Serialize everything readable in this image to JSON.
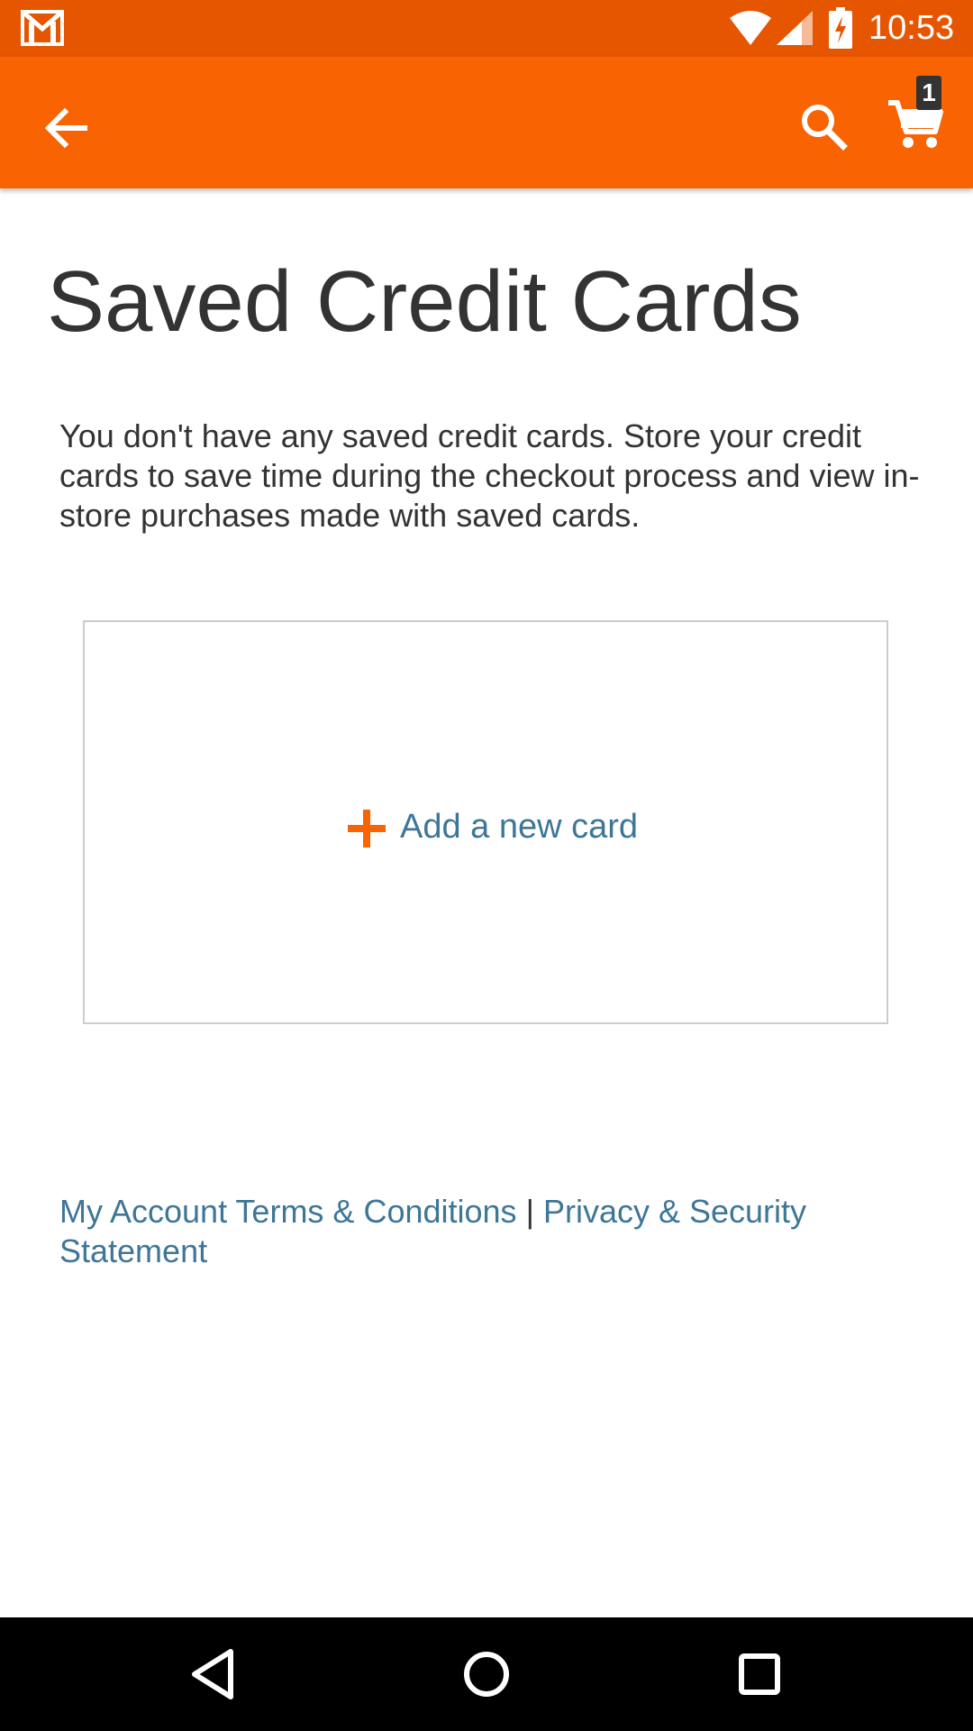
{
  "status_bar": {
    "time": "10:53",
    "icons": [
      "gmail-icon",
      "wifi-icon",
      "signal-icon",
      "battery-charging-icon"
    ]
  },
  "app_bar": {
    "back_icon": "arrow-back-icon",
    "search_icon": "search-icon",
    "cart_icon": "cart-icon",
    "cart_count": "1",
    "brand_color": "#f96302"
  },
  "main": {
    "title": "Saved Credit Cards",
    "intro": "You don't have any saved credit cards. Store your credit cards to save time during the checkout process and view in-store purchases made with saved cards.",
    "add_card_label": "Add a new card",
    "add_card_icon": "plus-icon"
  },
  "footer": {
    "terms_link": "My Account Terms & Conditions",
    "separator": "|",
    "privacy_link": "Privacy & Security Statement"
  },
  "nav_bar": {
    "icons": [
      "nav-back-icon",
      "nav-home-icon",
      "nav-recents-icon"
    ]
  },
  "colors": {
    "status_bar": "#e65500",
    "link": "#3e7697",
    "text": "#333333"
  }
}
